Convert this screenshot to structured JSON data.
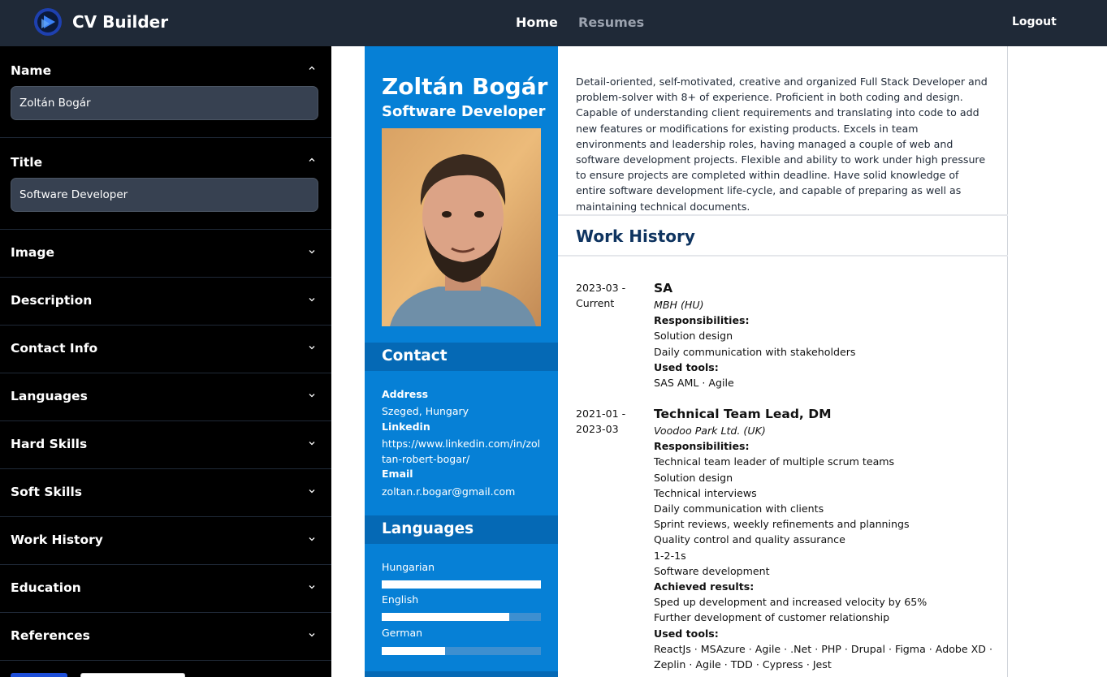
{
  "app": {
    "name": "CV Builder",
    "logo_icon": "cv-builder-logo-icon"
  },
  "nav": {
    "home": "Home",
    "resumes": "Resumes",
    "logout": "Logout"
  },
  "sidebar": {
    "name": {
      "label": "Name",
      "value": "Zoltán Bogár"
    },
    "title": {
      "label": "Title",
      "value": "Software Developer"
    },
    "sections": [
      "Image",
      "Description",
      "Contact Info",
      "Languages",
      "Hard Skills",
      "Soft Skills",
      "Work History",
      "Education",
      "References"
    ]
  },
  "resume": {
    "name": "Zoltán Bogár",
    "title": "Software Developer",
    "contact": {
      "heading": "Contact",
      "address_label": "Address",
      "address": "Szeged, Hungary",
      "linkedin_label": "Linkedin",
      "linkedin": "https://www.linkedin.com/in/zoltan-robert-bogar/",
      "email_label": "Email",
      "email": "zoltan.r.bogar@gmail.com"
    },
    "languages": {
      "heading": "Languages",
      "items": [
        {
          "name": "Hungarian",
          "level": 1.0
        },
        {
          "name": "English",
          "level": 0.8
        },
        {
          "name": "German",
          "level": 0.4
        }
      ]
    },
    "description": "Detail-oriented, self-motivated, creative and organized Full Stack Developer and problem-solver with 8+ of experience. Proficient in both coding and design. Capable of understanding client requirements and translating into code to add new features or modifications for existing products. Excels in team environments and leadership roles, having managed a couple of web and software development projects. Flexible and ability to work under high pressure to ensure projects are completed within deadline. Have solid knowledge of entire software development life-cycle, and capable of preparing as well as maintaining technical documents.",
    "work_history": {
      "heading": "Work History",
      "responsibilities_label": "Responsibilities:",
      "tools_label": "Used tools:",
      "results_label": "Achieved results:",
      "jobs": [
        {
          "date_start": "2023-03 -",
          "date_end": "Current",
          "role": "SA",
          "company": "MBH (HU)",
          "responsibilities": [
            "Solution design",
            "Daily communication with stakeholders"
          ],
          "tools": "SAS AML · Agile"
        },
        {
          "date_start": "2021-01 -",
          "date_end": "2023-03",
          "role": "Technical Team Lead, DM",
          "company": "Voodoo Park Ltd. (UK)",
          "responsibilities": [
            "Technical team leader of multiple scrum teams",
            "Solution design",
            "Technical interviews",
            "Daily communication with clients",
            "Sprint reviews, weekly refinements and plannings",
            "Quality control and quality assurance",
            "1-2-1s",
            "Software development"
          ],
          "results": [
            "Sped up development and increased velocity by 65%",
            "Further development of customer relationship"
          ],
          "tools": "ReactJs · MSAzure · Agile · .Net · PHP · Drupal · Figma · Adobe XD · Zeplin · Agile · TDD · Cypress · Jest"
        }
      ]
    }
  }
}
